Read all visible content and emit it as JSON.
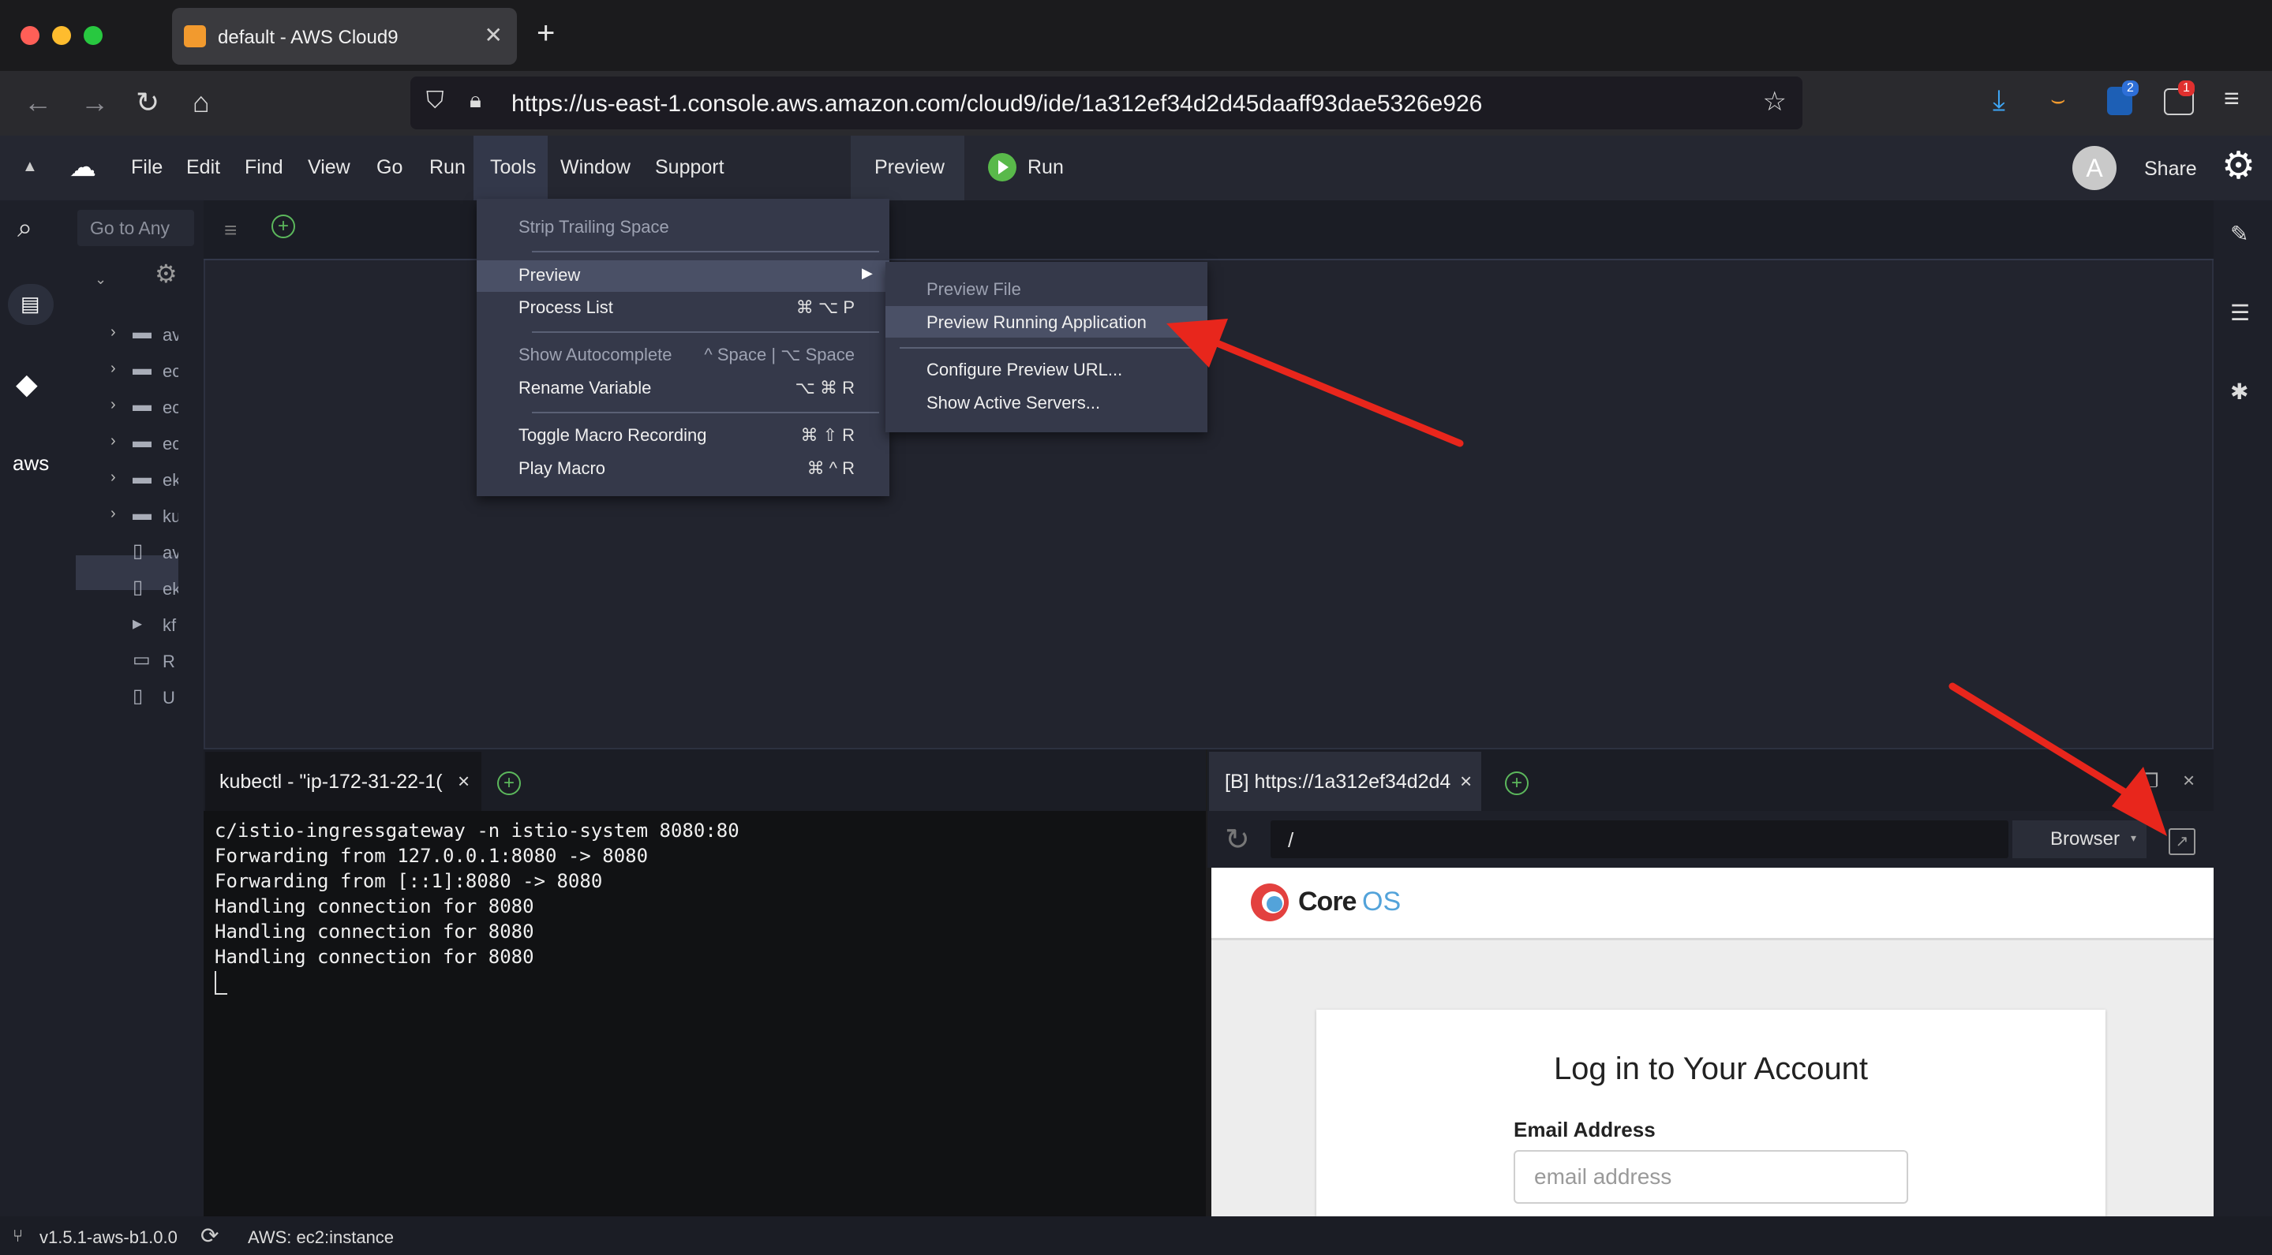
{
  "browser": {
    "tab_title": "default - AWS Cloud9",
    "url": "https://us-east-1.console.aws.amazon.com/cloud9/ide/1a312ef34d2d45daaff93dae5326e926",
    "ext_badge_1": "2",
    "ext_badge_2": "1"
  },
  "menubar": {
    "file": "File",
    "edit": "Edit",
    "find": "Find",
    "view": "View",
    "go": "Go",
    "run": "Run",
    "tools": "Tools",
    "window": "Window",
    "support": "Support",
    "preview": "Preview",
    "run_button": "Run",
    "avatar": "A",
    "share": "Share"
  },
  "tools_menu": {
    "strip_trailing_space": "Strip Trailing Space",
    "preview": "Preview",
    "process_list": "Process List",
    "process_list_shortcut": "⌘ ⌥ P",
    "show_autocomplete": "Show Autocomplete",
    "show_autocomplete_shortcut": "^ Space | ⌥ Space",
    "rename_variable": "Rename Variable",
    "rename_variable_shortcut": "⌥ ⌘ R",
    "toggle_macro": "Toggle Macro Recording",
    "toggle_macro_shortcut": "⌘ ⇧ R",
    "play_macro": "Play Macro",
    "play_macro_shortcut": "⌘ ^ R"
  },
  "preview_submenu": {
    "preview_file": "Preview File",
    "preview_running": "Preview Running Application",
    "configure_url": "Configure Preview URL...",
    "show_servers": "Show Active Servers..."
  },
  "sidebar": {
    "goto": "Go to Any",
    "aws_label": "aws",
    "tree": [
      "av",
      "ec",
      "ec",
      "ec",
      "ek",
      "ku",
      "av",
      "ek",
      "kf",
      "R",
      "U"
    ]
  },
  "terminal": {
    "tab_title": "kubectl - \"ip-172-31-22-1(",
    "lines": [
      "c/istio-ingressgateway -n istio-system 8080:80",
      "Forwarding from 127.0.0.1:8080 -> 8080",
      "Forwarding from [::1]:8080 -> 8080",
      "Handling connection for 8080",
      "Handling connection for 8080",
      "Handling connection for 8080"
    ]
  },
  "preview_pane": {
    "tab_title": "[B] https://1a312ef34d2d4",
    "path": "/",
    "browser_btn": "Browser",
    "logo_core": "Core",
    "logo_os": "OS",
    "login_title": "Log in to Your Account",
    "email_label": "Email Address",
    "email_placeholder": "email address"
  },
  "statusbar": {
    "version": "v1.5.1-aws-b1.0.0",
    "env": "AWS: ec2:instance"
  },
  "colors": {
    "menubar_bg": "#252731",
    "menu_bg": "#35394a",
    "run_green": "#59b94a",
    "annotation_red": "#e8261c"
  }
}
